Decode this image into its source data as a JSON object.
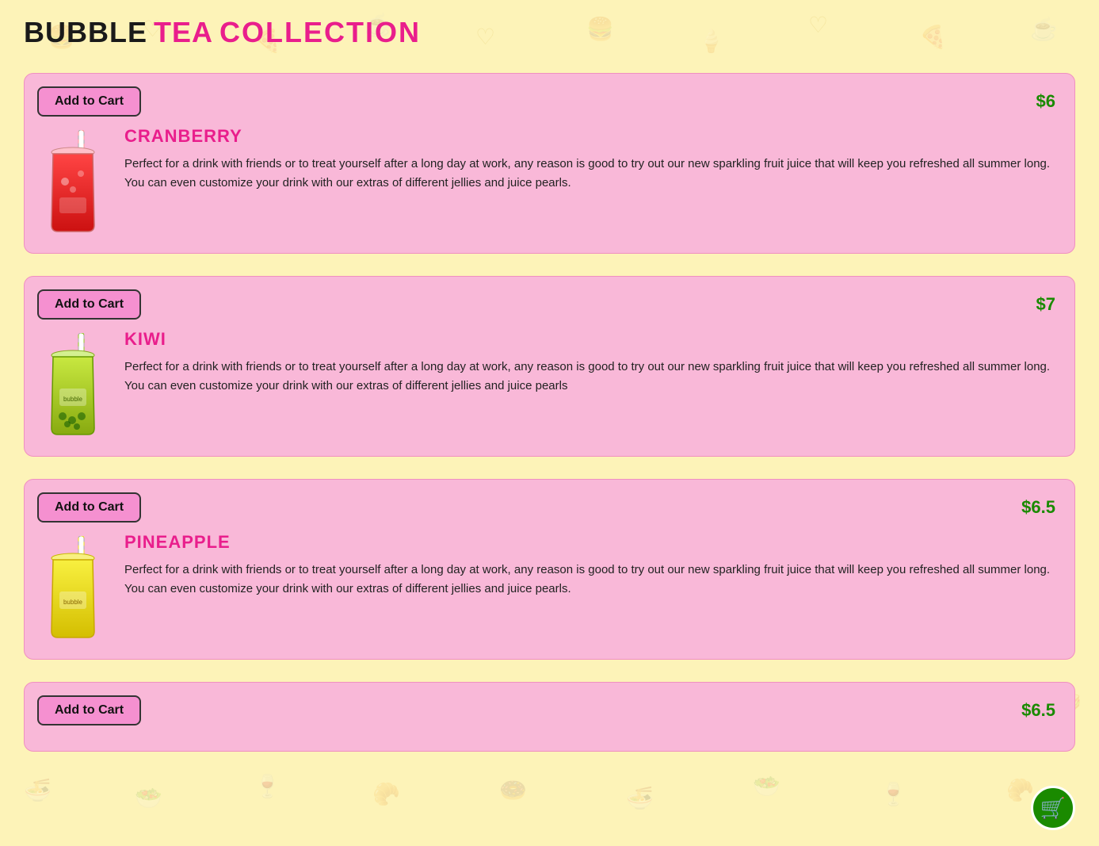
{
  "header": {
    "bubble": "BUBBLE",
    "tea": " TEA ",
    "collection": "COLLECTION"
  },
  "products": [
    {
      "id": "cranberry",
      "name": "CRANBERRY",
      "price": "$6",
      "description": "Perfect for a drink with friends or to treat yourself after a long day at work, any reason is good to try out our new sparkling fruit juice that will keep you refreshed all summer long. You can even customize your drink with our extras of different jellies and juice pearls.",
      "add_to_cart": "Add to Cart",
      "drink_color": "#e03020",
      "cup_type": "cranberry"
    },
    {
      "id": "kiwi",
      "name": "KIWI",
      "price": "$7",
      "description": "Perfect for a drink with friends or to treat yourself after a long day at work, any reason is good to try out our new sparkling fruit juice that will keep you refreshed all summer long. You can even customize your drink with our extras of different jellies and juice pearls",
      "add_to_cart": "Add to Cart",
      "drink_color": "#90c820",
      "cup_type": "kiwi"
    },
    {
      "id": "pineapple",
      "name": "PINEAPPLE",
      "price": "$6.5",
      "description": "Perfect for a drink with friends or to treat yourself after a long day at work, any reason is good to try out our new sparkling fruit juice that will keep you refreshed all summer long. You can even customize your drink with our extras of different jellies and juice pearls.",
      "add_to_cart": "Add to Cart",
      "drink_color": "#e8e020",
      "cup_type": "pineapple"
    },
    {
      "id": "fourth-item",
      "name": "",
      "price": "$6.5",
      "description": "",
      "add_to_cart": "Add to Cart",
      "drink_color": "#e8e020",
      "cup_type": "pineapple"
    }
  ],
  "cart": {
    "icon_label": "cart-icon"
  },
  "background": {
    "icons": [
      "🍔",
      "🍟",
      "🥤",
      "🍕",
      "🍰",
      "☕",
      "🍜",
      "🫖",
      "🍦",
      "🥗",
      "🍷",
      "🥐",
      "🍩",
      "🥪"
    ]
  }
}
